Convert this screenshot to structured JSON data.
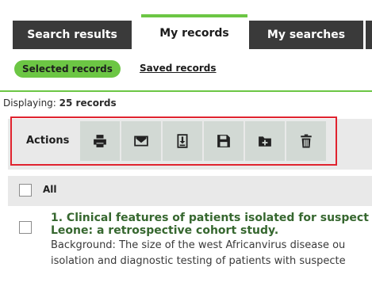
{
  "tabs": [
    {
      "label": "Search results",
      "active": false
    },
    {
      "label": "My records",
      "active": true
    },
    {
      "label": "My searches",
      "active": false
    }
  ],
  "subtabs": {
    "selected_label": "Selected records",
    "saved_label": "Saved records"
  },
  "display": {
    "prefix": "Displaying:",
    "count_text": "25 records"
  },
  "actions": {
    "label": "Actions",
    "buttons": [
      {
        "icon": "print-icon"
      },
      {
        "icon": "email-icon"
      },
      {
        "icon": "export-icon"
      },
      {
        "icon": "save-icon"
      },
      {
        "icon": "add-to-folder-icon"
      },
      {
        "icon": "delete-icon"
      }
    ]
  },
  "select_all": {
    "label": "All"
  },
  "records": [
    {
      "title_line1": "1. Clinical features of patients isolated for suspect",
      "title_line2": "Leone: a retrospective cohort study.",
      "body_line1": "Background: The size of the west Africanvirus disease ou",
      "body_line2": "isolation and diagnostic testing of patients with suspecte"
    }
  ],
  "colors": {
    "accent_green": "#6cc644",
    "highlight_red": "#e0232f",
    "title_green": "#36672f"
  }
}
